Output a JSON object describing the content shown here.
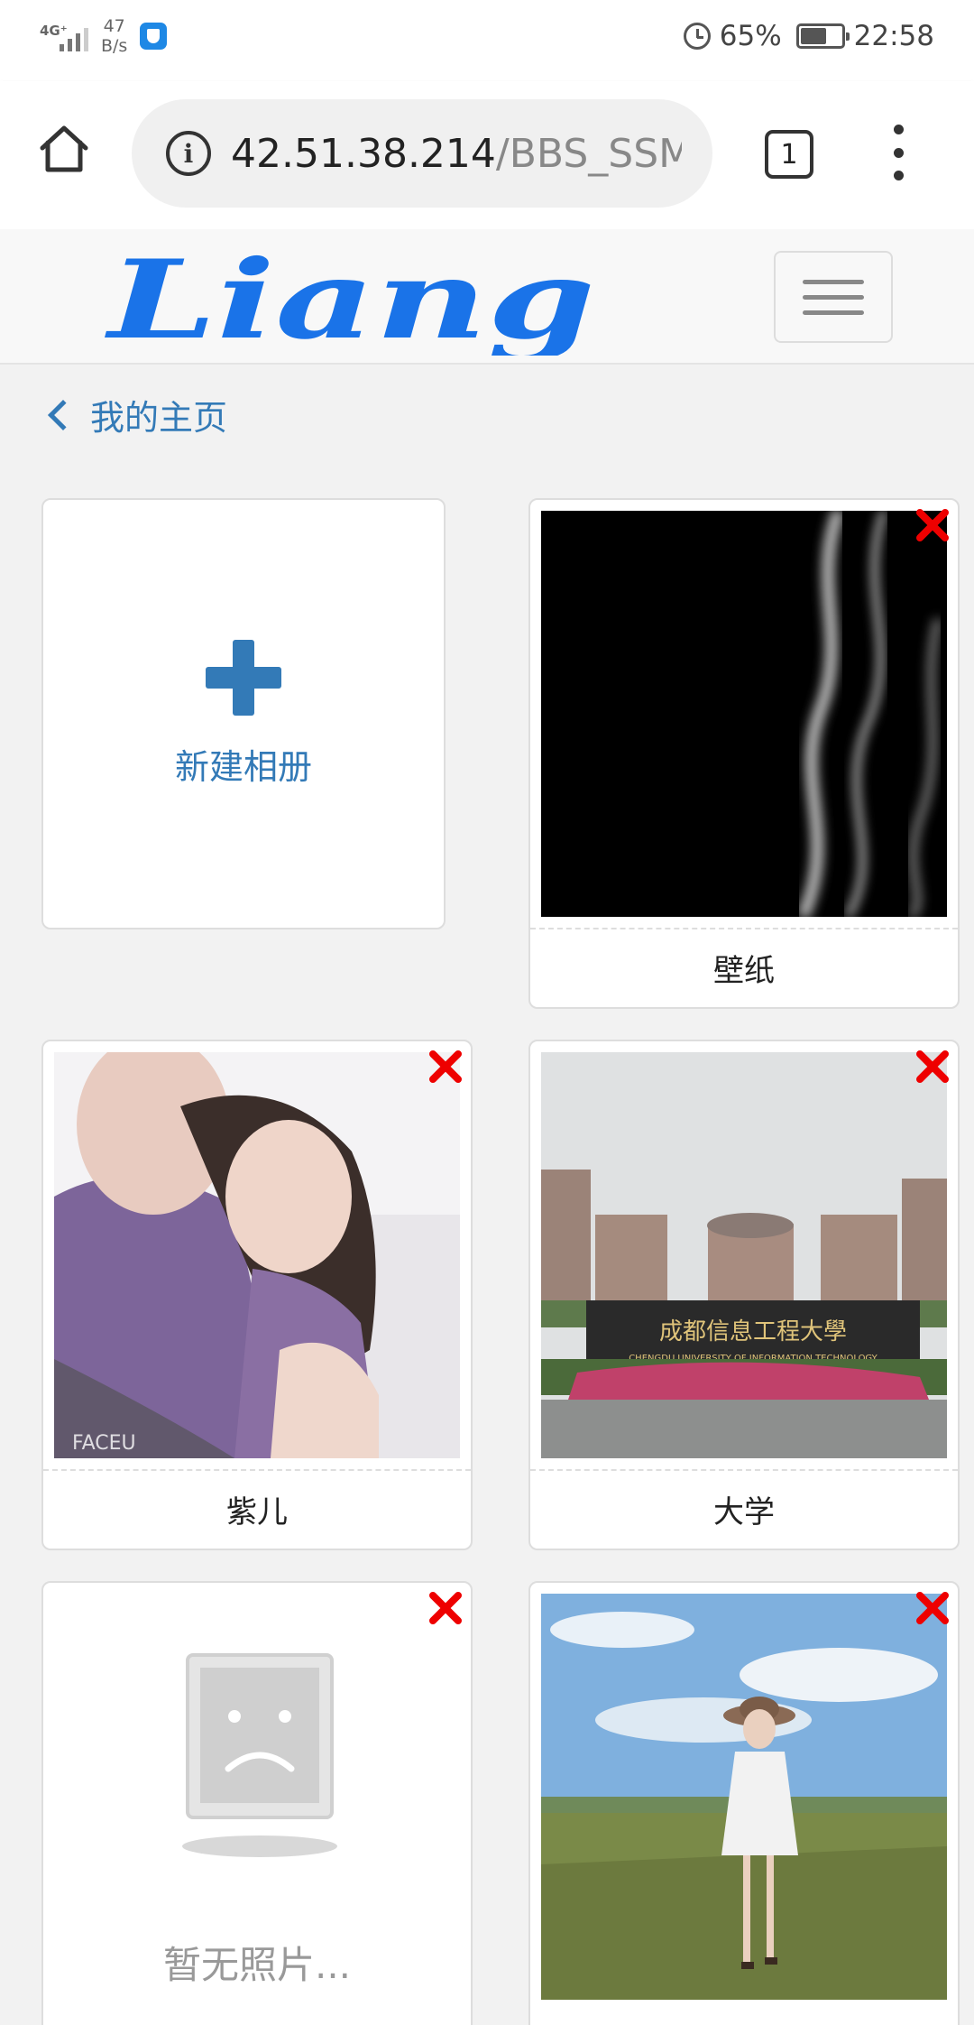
{
  "status_bar": {
    "network": "4G⁺",
    "speed_value": "47",
    "speed_unit": "B/s",
    "battery": "65%",
    "battery_level": 0.65,
    "time": "22:58",
    "icons": [
      "signal-icon",
      "shield-icon",
      "alarm-icon",
      "battery-icon"
    ]
  },
  "browser": {
    "url_host": "42.51.38.214",
    "url_path": "/BBS_SSM",
    "tab_count": "1",
    "icons": [
      "home-icon",
      "info-icon",
      "tabs-icon",
      "more-icon"
    ]
  },
  "site": {
    "logo_text": "Liang",
    "brand_color": "#1a73e8",
    "link_color": "#337ab7"
  },
  "breadcrumb": {
    "back_label": "我的主页"
  },
  "albums": {
    "new_album_label": "新建相册",
    "items": [
      {
        "name": "壁纸"
      },
      {
        "name": "紫儿"
      },
      {
        "name": "大学"
      },
      {
        "name": "",
        "placeholder": "暂无照片..."
      },
      {
        "name": ""
      }
    ],
    "photo_sign_text": "成都信息工程大學",
    "photo_sign_subtext": "CHENGDU UNIVERSITY OF INFORMATION TECHNOLOGY",
    "photo_watermark": "FACEU"
  }
}
